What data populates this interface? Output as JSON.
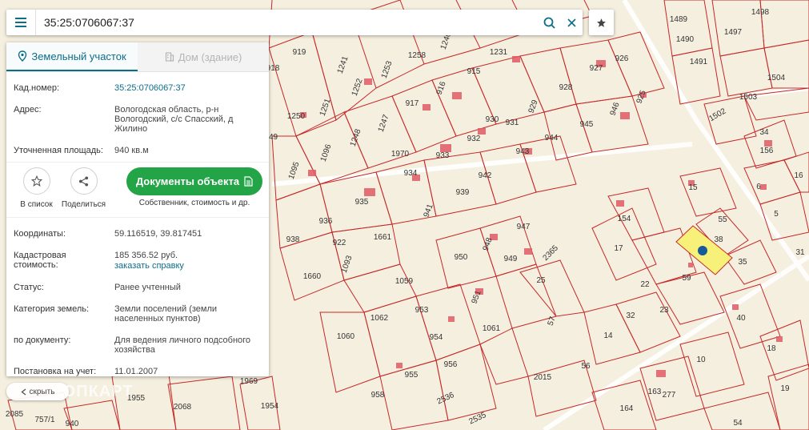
{
  "search": {
    "value": "35:25:0706067:37"
  },
  "tabs": [
    {
      "label": "Земельный участок"
    },
    {
      "label": "Дом (здание)"
    }
  ],
  "info_top": [
    {
      "key": "Кад.номер:",
      "value": "35:25:0706067:37"
    },
    {
      "key": "Адрес:",
      "value": "Вологодская область, р-н Вологодский, с/с Спасский, д Жилино"
    },
    {
      "key": "Уточненная площадь:",
      "value": "940 кв.м"
    }
  ],
  "actions": {
    "to_list": "В список",
    "share": "Поделиться",
    "docs_button": "Документы объекта",
    "docs_sub": "Собственник, стоимость и др."
  },
  "info_bottom": [
    {
      "key": "Координаты:",
      "value": "59.116519, 39.817451"
    },
    {
      "key": "Кадастровая стоимость:",
      "value": "185 356.52 руб.",
      "link": "заказать справку"
    },
    {
      "key": "Статус:",
      "value": "Ранее учтенный"
    },
    {
      "key": "Категория земель:",
      "value": "Земли поселений (земли населенных пунктов)"
    },
    {
      "key": "по документу:",
      "value": "Для ведения личного подсобного хозяйства"
    },
    {
      "key": "Постановка на учет:",
      "value": "11.01.2007"
    }
  ],
  "hide_label": "скрыть",
  "watermark": "ТОПКАРТ",
  "map": {
    "labels": [
      "1489",
      "1498",
      "1490",
      "1497",
      "1491",
      "1504",
      "1503",
      "1502",
      "34",
      "156",
      "6",
      "16",
      "5",
      "31",
      "15",
      "55",
      "38",
      "35",
      "154",
      "17",
      "22",
      "59",
      "23",
      "40",
      "18",
      "19",
      "10",
      "163",
      "277",
      "164",
      "54",
      "2015",
      "56",
      "14",
      "32",
      "57",
      "25",
      "2365",
      "947",
      "948",
      "949",
      "950",
      "951",
      "1061",
      "1059",
      "953",
      "1062",
      "954",
      "1060",
      "956",
      "955",
      "958",
      "2535",
      "2536",
      "1970",
      "1969",
      "1954",
      "1955",
      "2068",
      "2085",
      "757/1",
      "940",
      "939",
      "941",
      "942",
      "943",
      "944",
      "945",
      "946",
      "925",
      "926",
      "927",
      "928",
      "929",
      "930",
      "931",
      "932",
      "933",
      "934",
      "935",
      "936",
      "938",
      "1660",
      "1661",
      "922",
      "1093",
      "1095",
      "1096",
      "1247",
      "1248",
      "1249",
      "1250",
      "1251",
      "1252",
      "1253",
      "1258",
      "1240",
      "1241",
      "919",
      "918",
      "917",
      "916",
      "915",
      "1231"
    ],
    "colors": {
      "background": "#f5efdf",
      "parcel_border": "#c62828",
      "building": "#e05a66",
      "selected_fill": "#f7f17a",
      "marker": "#155b9a",
      "accent": "#0a6e8a",
      "button_green": "#23a447"
    }
  }
}
